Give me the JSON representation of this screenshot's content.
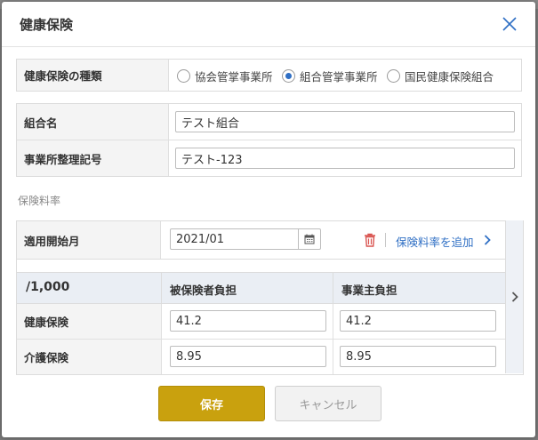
{
  "dialog": {
    "title": "健康保険"
  },
  "insurance_type": {
    "label": "健康保険の種類",
    "options": [
      {
        "label": "協会管掌事業所",
        "selected": false
      },
      {
        "label": "組合管掌事業所",
        "selected": true
      },
      {
        "label": "国民健康保険組合",
        "selected": false
      }
    ]
  },
  "union": {
    "name_label": "組合名",
    "name_value": "テスト組合",
    "office_code_label": "事業所整理記号",
    "office_code_value": "テスト-123"
  },
  "rates": {
    "section_label": "保険料率",
    "start_month_label": "適用開始月",
    "start_month_value": "2021/01",
    "add_rate_link": "保険料率を追加",
    "table": {
      "unit_header": "/1,000",
      "col_insured": "被保険者負担",
      "col_employer": "事業主負担",
      "rows": [
        {
          "label": "健康保険",
          "insured": "41.2",
          "employer": "41.2"
        },
        {
          "label": "介護保険",
          "insured": "8.95",
          "employer": "8.95"
        }
      ]
    }
  },
  "buttons": {
    "save": "保存",
    "cancel": "キャンセル"
  },
  "colors": {
    "accent_blue": "#2f6fc4",
    "save_gold": "#c9a10e",
    "delete_red": "#d9534f"
  }
}
